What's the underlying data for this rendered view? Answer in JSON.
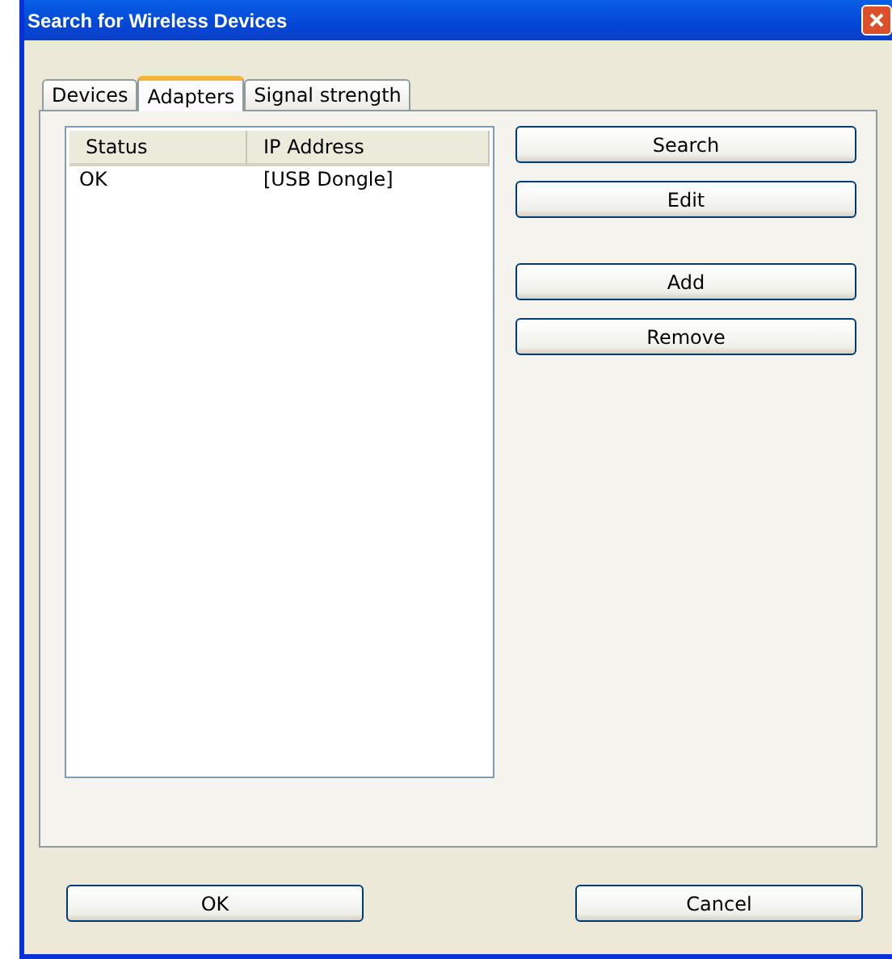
{
  "window": {
    "title": "Search for Wireless Devices"
  },
  "tabs": [
    {
      "label": "Devices",
      "selected": false
    },
    {
      "label": "Adapters",
      "selected": true
    },
    {
      "label": "Signal strength",
      "selected": false
    }
  ],
  "table": {
    "columns": [
      "Status",
      "IP Address"
    ],
    "rows": [
      [
        "OK",
        "[USB Dongle]"
      ]
    ]
  },
  "side_buttons": [
    [
      "Search",
      "Edit"
    ],
    [
      "Add",
      "Remove"
    ]
  ],
  "buttons": [
    "OK",
    "Cancel"
  ]
}
